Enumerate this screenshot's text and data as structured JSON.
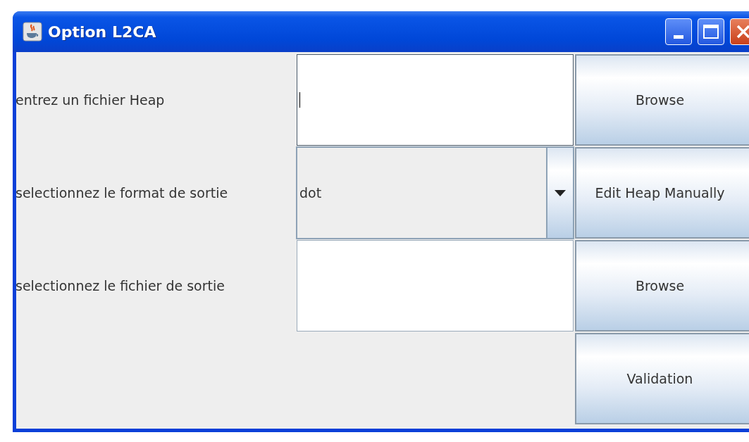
{
  "window": {
    "title": "Option L2CA"
  },
  "rows": [
    {
      "label": "entrez un fichier Heap",
      "kind": "text",
      "value": "",
      "focused": true,
      "button": "Browse"
    },
    {
      "label": "selectionnez le format de sortie",
      "kind": "combo",
      "value": "dot",
      "button": "Edit Heap Manually"
    },
    {
      "label": "selectionnez le fichier de sortie",
      "kind": "text",
      "value": "",
      "focused": false,
      "button": "Browse"
    },
    {
      "kind": "none",
      "button": "Validation"
    }
  ]
}
